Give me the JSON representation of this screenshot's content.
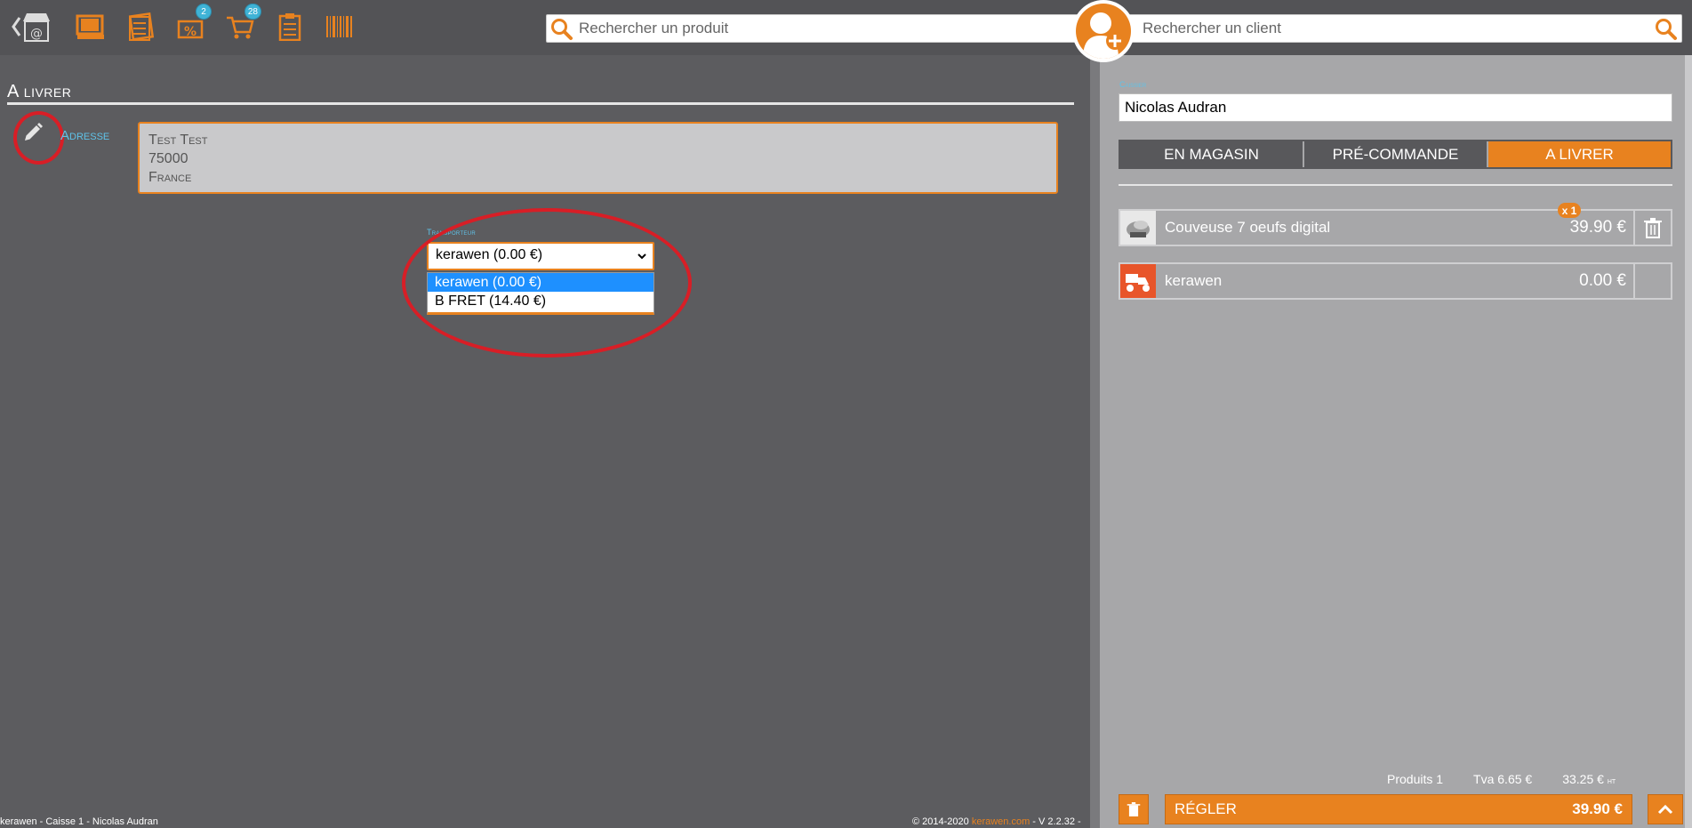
{
  "toolbar": {
    "badges": {
      "pending": "2",
      "cart": "28"
    }
  },
  "search": {
    "product_placeholder": "Rechercher un produit",
    "client_placeholder": "Rechercher un client"
  },
  "delivery": {
    "title": "A livrer",
    "address_label": "Adresse",
    "address_lines": [
      "Test Test",
      "75000",
      "France"
    ],
    "carrier_label": "Transporteur",
    "carrier_selected": "kerawen (0.00 €)",
    "carrier_options": [
      "kerawen (0.00 €)",
      "B FRET (14.40 €)"
    ]
  },
  "footer": {
    "left": "kerawen - Caisse 1 - Nicolas Audran",
    "right_prefix": "© 2014-2020 ",
    "brand": "kerawen.com",
    "right_suffix": " - V 2.2.32 -"
  },
  "cart": {
    "cashier_label": "Caissier",
    "cashier_name": "Nicolas Audran",
    "tabs": [
      "EN MAGASIN",
      "PRÉ-COMMANDE",
      "A LIVRER"
    ],
    "active_tab": "A LIVRER",
    "lines": [
      {
        "name": "Couveuse 7 oeufs digital",
        "price": "39.90 €",
        "qty": "x 1"
      },
      {
        "name": "kerawen",
        "price": "0.00 €"
      }
    ],
    "totals": {
      "products": "Produits 1",
      "tva": "Tva 6.65 €",
      "ht_amount": "33.25 €",
      "ht_suffix": "HT"
    },
    "pay_label": "RÉGLER",
    "pay_amount": "39.90 €"
  },
  "colors": {
    "accent": "#e8821f",
    "panel": "#a7a7a9",
    "background": "#5c5c5f",
    "highlight": "#d81e26",
    "label": "#5fc2e8"
  }
}
